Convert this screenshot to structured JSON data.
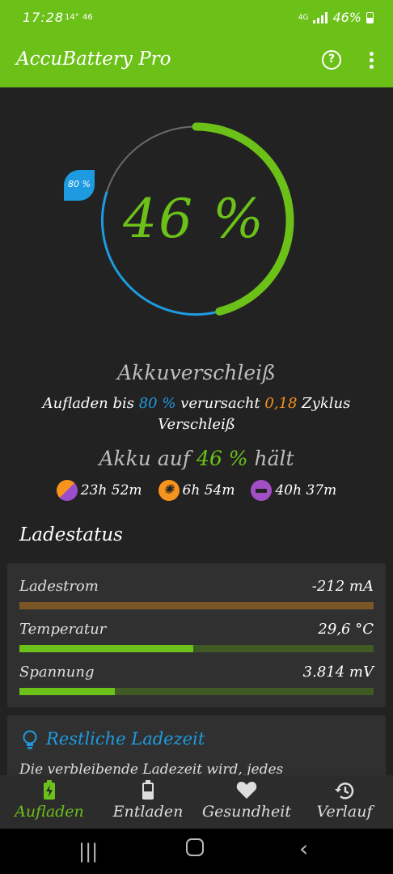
{
  "status_bar": {
    "time": "17:28",
    "temp": "14°",
    "extra": "46",
    "network": "4G",
    "battery": "46%"
  },
  "app_bar": {
    "title": "AccuBattery Pro"
  },
  "gauge": {
    "percent_label": "46 %",
    "percent": 46,
    "alarm_label": "80 %",
    "alarm_percent": 80
  },
  "wear": {
    "heading": "Akkuverschleiß",
    "line_pre": "Aufladen bis ",
    "line_target": "80 %",
    "line_mid": " verursacht ",
    "line_cycles": "0,18",
    "line_post": " Zyklus Verschleiß"
  },
  "hold": {
    "pre": "Akku auf ",
    "percent": "46 %",
    "post": " hält",
    "times": [
      {
        "icon": "mixed-usage-icon",
        "value": "23h 52m"
      },
      {
        "icon": "screen-on-icon",
        "value": "6h 54m"
      },
      {
        "icon": "sleep-icon",
        "value": "40h 37m"
      }
    ]
  },
  "charge_status": {
    "heading": "Ladestatus",
    "rows": [
      {
        "label": "Ladestrom",
        "value": "-212 mA",
        "level": 1.0
      },
      {
        "label": "Temperatur",
        "value": "29,6 °C",
        "level": 0.49
      },
      {
        "label": "Spannung",
        "value": "3.814 mV",
        "level": 0.27
      }
    ]
  },
  "remaining": {
    "heading": "Restliche Ladezeit",
    "text": "Die verbleibende Ladezeit wird, jedes"
  },
  "bottom_nav": [
    {
      "label": "Aufladen",
      "icon": "charging-battery-icon",
      "active": true
    },
    {
      "label": "Entladen",
      "icon": "battery-icon",
      "active": false
    },
    {
      "label": "Gesundheit",
      "icon": "heart-icon",
      "active": false
    },
    {
      "label": "Verlauf",
      "icon": "history-icon",
      "active": false
    }
  ],
  "colors": {
    "accent": "#6cc119",
    "blue": "#1e9be0",
    "orange": "#f7941d",
    "brown": "#7a5526",
    "dark_green": "#3f5a24"
  }
}
